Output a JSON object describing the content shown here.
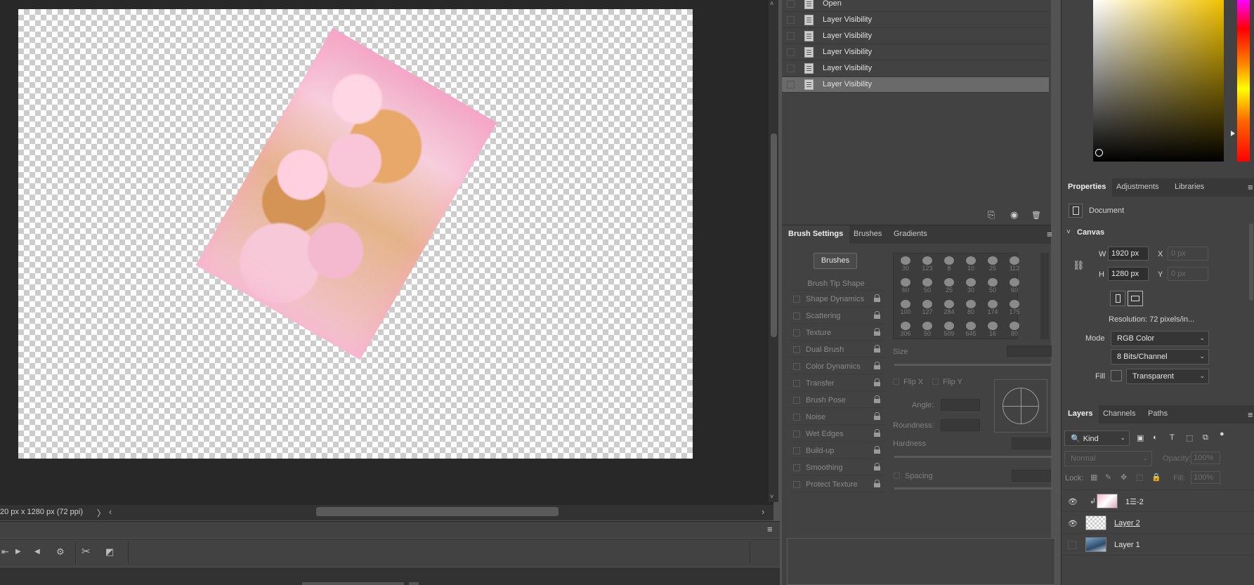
{
  "document": {
    "status_text": "20 px x 1280 px (72 ppi)",
    "status_arrow": "〉",
    "scroll_left_arrow": "‹",
    "scroll_right_arrow": "›"
  },
  "timeline": {
    "menu_icon": "≡",
    "controls": [
      "first-frame-icon",
      "play-icon",
      "prev-frame-icon",
      "settings-icon",
      "scissors-icon",
      "transition-icon"
    ],
    "control_glyphs": [
      "⇤",
      "▶",
      "◀",
      "⚙",
      "✂",
      "◩"
    ]
  },
  "history": {
    "items": [
      {
        "label": "Open",
        "selected": false
      },
      {
        "label": "Layer Visibility",
        "selected": false
      },
      {
        "label": "Layer Visibility",
        "selected": false
      },
      {
        "label": "Layer Visibility",
        "selected": false
      },
      {
        "label": "Layer Visibility",
        "selected": false
      },
      {
        "label": "Layer Visibility",
        "selected": true
      }
    ],
    "footer_icons": [
      "new-document-icon",
      "snapshot-icon",
      "delete-icon"
    ],
    "footer_glyphs": [
      "⎘",
      "◉",
      "🗑"
    ]
  },
  "brush_panel": {
    "tabs": [
      "Brush Settings",
      "Brushes",
      "Gradients"
    ],
    "active_tab": "Brush Settings",
    "menu_icon": "≡",
    "brushes_button": "Brushes",
    "tip_shape": "Brush Tip Shape",
    "options": [
      "Shape Dynamics",
      "Scattering",
      "Texture",
      "Dual Brush",
      "Color Dynamics",
      "Transfer",
      "Brush Pose",
      "Noise",
      "Wet Edges",
      "Build-up",
      "Smoothing",
      "Protect Texture"
    ],
    "preset_sizes": [
      "30",
      "123",
      "8",
      "10",
      "25",
      "112",
      "60",
      "50",
      "25",
      "30",
      "50",
      "60",
      "100",
      "127",
      "284",
      "80",
      "174",
      "175",
      "306",
      "50",
      "509",
      "645",
      "16",
      "80"
    ],
    "size_label": "Size",
    "flip_x": "Flip X",
    "flip_y": "Flip Y",
    "angle_label": "Angle:",
    "roundness_label": "Roundness:",
    "hardness_label": "Hardness",
    "spacing_label": "Spacing"
  },
  "properties": {
    "tabs": [
      "Properties",
      "Adjustments",
      "Libraries"
    ],
    "active_tab": "Properties",
    "menu_icon": "≡",
    "doc_label": "Document",
    "canvas_header": "Canvas",
    "w_label": "W",
    "w_value": "1920 px",
    "h_label": "H",
    "h_value": "1280 px",
    "x_label": "X",
    "x_value": "0 px",
    "y_label": "Y",
    "y_value": "0 px",
    "resolution": "Resolution: 72 pixels/in...",
    "mode_label": "Mode",
    "mode_value": "RGB Color",
    "bits_value": "8 Bits/Channel",
    "fill_label": "Fill",
    "fill_value": "Transparent"
  },
  "layers": {
    "tabs": [
      "Layers",
      "Channels",
      "Paths"
    ],
    "active_tab": "Layers",
    "menu_icon": "≡",
    "kind_label": "Kind",
    "blend_mode": "Normal",
    "opacity_label": "Opacity:",
    "opacity_value": "100%",
    "lock_label": "Lock:",
    "fill_label": "Fill:",
    "fill_value": "100%",
    "items": [
      {
        "name": "1☰-2",
        "visible": true,
        "clipped": true
      },
      {
        "name": "Layer 2",
        "visible": true,
        "clipped": false
      },
      {
        "name": "Layer 1",
        "visible": false,
        "clipped": false
      }
    ]
  },
  "colors": {
    "panel_bg": "#424242",
    "canvas_bg": "#282828",
    "selected_row": "#6a6a6a",
    "picker_hue": "#f2c200"
  }
}
